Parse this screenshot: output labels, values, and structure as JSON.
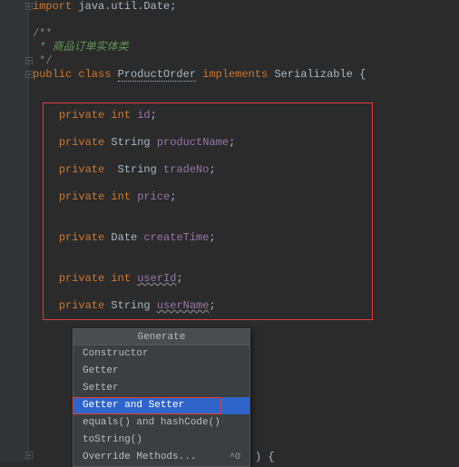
{
  "code": {
    "import_kw": "import",
    "import_pkg": " java.util.Date;",
    "cmt_open": "/**",
    "cmt_body": " * 商品订单实体类",
    "cmt_close": " */",
    "class_kw": "public class ",
    "class_name": "ProductOrder",
    "impl_kw": " implements ",
    "iface": "Serializable",
    "brace": " {",
    "f1_mod": "private ",
    "f1_type": "int ",
    "f1_name": "id",
    "semi": ";",
    "f2_mod": "private ",
    "f2_type": "String ",
    "f2_name": "productName",
    "f3_mod": "private  ",
    "f3_type": "String ",
    "f3_name": "tradeNo",
    "f4_mod": "private ",
    "f4_type": "int ",
    "f4_name": "price",
    "f5_mod": "private ",
    "f5_type": "Date ",
    "f5_name": "createTime",
    "f6_mod": "private ",
    "f6_type": "int ",
    "f6_name": "userId",
    "f7_mod": "private ",
    "f7_type": "String ",
    "f7_name": "userName",
    "tail": ")  {",
    "shortcut": "^O"
  },
  "popup": {
    "title": "Generate",
    "items": [
      "Constructor",
      "Getter",
      "Setter",
      "Getter and Setter",
      "equals() and hashCode()",
      "toString()",
      "Override Methods..."
    ]
  }
}
